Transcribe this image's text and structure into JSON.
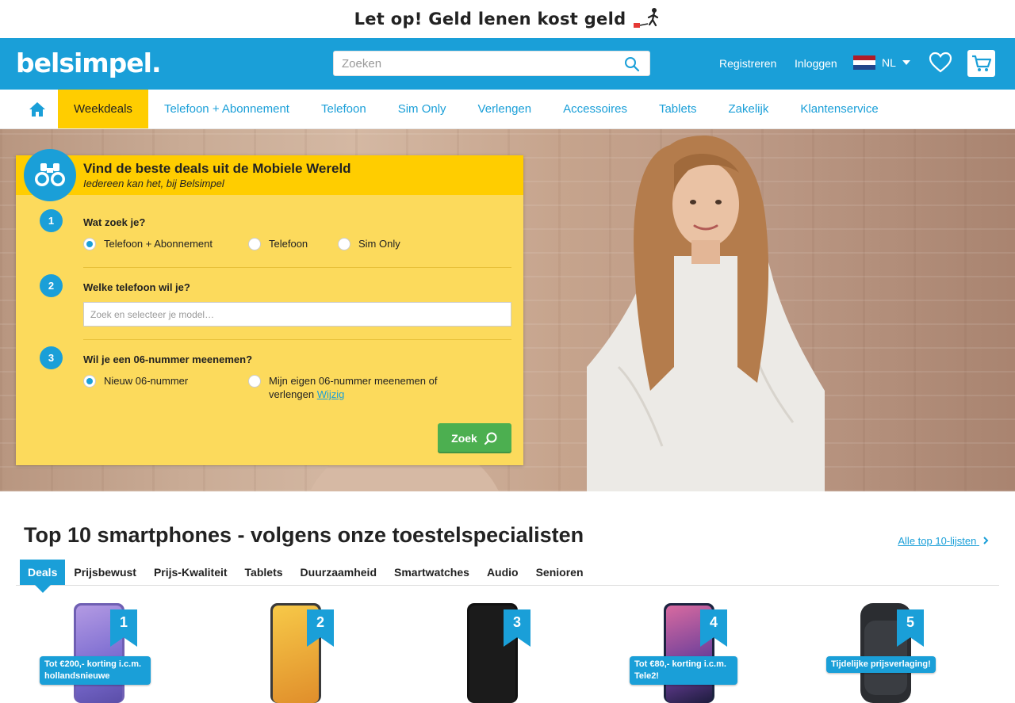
{
  "banner": {
    "warning_text": "Let op! Geld lenen kost geld"
  },
  "header": {
    "logo": "belsimpel.",
    "search_placeholder": "Zoeken",
    "register_label": "Registreren",
    "login_label": "Inloggen",
    "language": "NL"
  },
  "nav": {
    "items": [
      {
        "label": "Weekdeals",
        "active": true
      },
      {
        "label": "Telefoon + Abonnement"
      },
      {
        "label": "Telefoon"
      },
      {
        "label": "Sim Only"
      },
      {
        "label": "Verlengen"
      },
      {
        "label": "Accessoires"
      },
      {
        "label": "Tablets"
      },
      {
        "label": "Zakelijk"
      },
      {
        "label": "Klantenservice"
      }
    ]
  },
  "finder": {
    "title": "Vind de beste deals uit de Mobiele Wereld",
    "subtitle": "Iedereen kan het, bij Belsimpel",
    "step1": {
      "number": "1",
      "question": "Wat zoek je?",
      "options": [
        "Telefoon + Abonnement",
        "Telefoon",
        "Sim Only"
      ],
      "selected": "Telefoon + Abonnement"
    },
    "step2": {
      "number": "2",
      "question": "Welke telefoon wil je?",
      "placeholder": "Zoek en selecteer je model…"
    },
    "step3": {
      "number": "3",
      "question": "Wil je een 06-nummer meenemen?",
      "option_new": "Nieuw 06-nummer",
      "option_keep": "Mijn eigen 06-nummer meenemen of verlengen",
      "change_link": "Wijzig",
      "selected": "Nieuw 06-nummer"
    },
    "search_button": "Zoek"
  },
  "top10": {
    "title": "Top 10 smartphones - volgens onze toestelspecialisten",
    "all_lists_link": "Alle top 10-lijsten",
    "tabs": [
      "Deals",
      "Prijsbewust",
      "Prijs-Kwaliteit",
      "Tablets",
      "Duurzaamheid",
      "Smartwatches",
      "Audio",
      "Senioren"
    ],
    "active_tab": "Deals",
    "products": [
      {
        "rank": "1",
        "promo": "Tot €200,- korting i.c.m. hollandsnieuwe"
      },
      {
        "rank": "2",
        "promo": ""
      },
      {
        "rank": "3",
        "promo": ""
      },
      {
        "rank": "4",
        "promo": "Tot €80,- korting i.c.m. Tele2!"
      },
      {
        "rank": "5",
        "promo": "Tijdelijke prijsverlaging!"
      }
    ]
  },
  "colors": {
    "brand_blue": "#1a9fd8",
    "brand_yellow": "#ffcd00",
    "panel_yellow": "#fcda5c",
    "cta_green": "#4caf50"
  }
}
